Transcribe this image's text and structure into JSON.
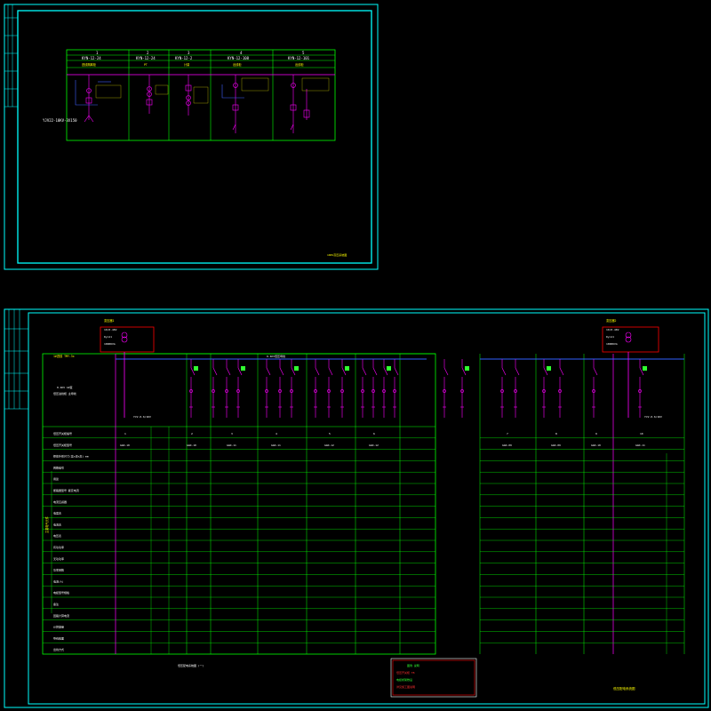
{
  "top_sheet": {
    "columns": [
      {
        "num": "1",
        "model": "KYN-12-24",
        "role": "进线隔离柜"
      },
      {
        "num": "2",
        "model": "KYN-12-24",
        "role": "PT"
      },
      {
        "num": "3",
        "model": "KYN-12-2",
        "role": "计量"
      },
      {
        "num": "4",
        "model": "KYN-12-108",
        "role": "出线柜"
      },
      {
        "num": "5",
        "model": "KYN-12-101",
        "role": "出线柜"
      }
    ],
    "bottom_note": "YJV22-10KV-3X150",
    "title_label": "10KV高压系统图"
  },
  "bottom_sheet": {
    "transformer_left": {
      "title": "变压器1",
      "lines": [
        "10/0.4KV",
        "Dyn11",
        "1000KVA"
      ]
    },
    "transformer_right": {
      "title": "变压器2",
      "lines": [
        "10/0.4KV",
        "Dyn11",
        "1000KVA"
      ]
    },
    "bus_label": "0.4KV低压母线",
    "left_note": "1#进线 TMY-3x",
    "incoming_note_a": "0.4KV 1#变",
    "incoming_note_b": "低压进线柜 主母线",
    "feeder_bottom_label": "YJV-0.6/1KV",
    "row_labels": [
      "低压开关柜编号",
      "低压开关柜型号",
      "柜体外形尺寸(宽x深x高) mm",
      "回路编号",
      "用途",
      "断路器型号 额定电流",
      "电流互感器",
      "电度表",
      "电流表",
      "电压表",
      "有功功率",
      "无功功率",
      "功率因数",
      "电流(A)",
      "电缆型号规格",
      "备注",
      "回路计算电流",
      "计算容量",
      "导线截面",
      "出线方式"
    ],
    "side_label": "主要电气元件",
    "col_groups": [
      {
        "num": "1",
        "model": "GGD-10"
      },
      {
        "num": "2",
        "model": "GGD-10"
      },
      {
        "num": "3",
        "model": "GGD-11"
      },
      {
        "num": "4",
        "model": "GGD-11"
      },
      {
        "num": "5",
        "model": "GGD-12"
      },
      {
        "num": "6",
        "model": "GGD-12"
      }
    ],
    "right_cols": [
      {
        "num": "7",
        "model": "GGD-09"
      },
      {
        "num": "8",
        "model": "GGD-09"
      },
      {
        "num": "9",
        "model": "GGD-10"
      },
      {
        "num": "10",
        "model": "GGD-11"
      }
    ],
    "bottom_note": "低压配电系统图 (一)",
    "legend_title": "图例  说明",
    "legend_lines": [
      "低压开关柜 TB",
      "电缆桥架敷设",
      "详见施工图说明"
    ],
    "sheet_title": "低压配电系统图"
  },
  "colors": {
    "frame": "#00ffff",
    "grid": "#00ff00",
    "bus": "#ff00ff",
    "highlight": "#ff0000",
    "label": "#ffff00",
    "text": "#ffffff"
  }
}
